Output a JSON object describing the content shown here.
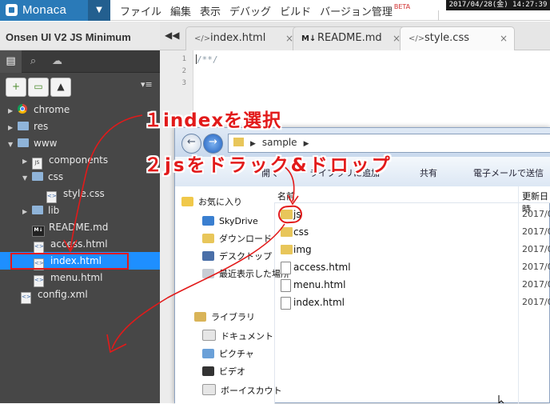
{
  "topbar": {
    "brand": "Monaca",
    "dropdown_icon": "▼",
    "menu": [
      "ファイル",
      "編集",
      "表示",
      "デバッグ",
      "ビルド",
      "バージョン管理"
    ],
    "beta": "BETA",
    "clock": "2017/04/28(金) 14:27:39"
  },
  "sidebar": {
    "project_title": "Onsen UI V2 JS Minimum",
    "tabs": [
      "files-icon",
      "search-icon",
      "cloud-icon"
    ],
    "tools": [
      "new-file-icon",
      "new-folder-icon",
      "upload-icon"
    ],
    "tree": [
      {
        "label": "chrome",
        "type": "chrome",
        "expanded": false
      },
      {
        "label": "res",
        "type": "folder",
        "expanded": false
      },
      {
        "label": "www",
        "type": "folder",
        "expanded": true
      },
      {
        "label": "components",
        "type": "js",
        "expanded": false
      },
      {
        "label": "css",
        "type": "folder",
        "expanded": true
      },
      {
        "label": "style.css",
        "type": "css"
      },
      {
        "label": "lib",
        "type": "folder",
        "expanded": false
      },
      {
        "label": "README.md",
        "type": "md"
      },
      {
        "label": "access.html",
        "type": "html"
      },
      {
        "label": "index.html",
        "type": "html",
        "selected": true
      },
      {
        "label": "menu.html",
        "type": "html"
      },
      {
        "label": "config.xml",
        "type": "xml"
      }
    ]
  },
  "editor": {
    "tabs": [
      {
        "label": "index.html",
        "icon": "code-icon"
      },
      {
        "label": "README.md",
        "icon": "markdown-icon"
      },
      {
        "label": "style.css",
        "icon": "code-icon",
        "active": true
      }
    ],
    "line_numbers": [
      "1",
      "2",
      "3"
    ],
    "code_line1": "/**/"
  },
  "explorer": {
    "path": "sample",
    "toolbar": [
      "開く",
      "ライブラリに追加",
      "共有",
      "電子メールで送信"
    ],
    "nav": [
      "お気に入り",
      "SkyDrive",
      "ダウンロード",
      "デスクトップ",
      "最近表示した場所",
      "ライブラリ",
      "ドキュメント",
      "ピクチャ",
      "ビデオ",
      "ボーイスカウト"
    ],
    "col_name": "名前",
    "col_date": "更新日時",
    "files": [
      {
        "name": "js",
        "type": "folder",
        "date": "2017/0"
      },
      {
        "name": "css",
        "type": "folder",
        "date": "2017/0"
      },
      {
        "name": "img",
        "type": "folder",
        "date": "2017/0"
      },
      {
        "name": "access.html",
        "type": "html",
        "date": "2017/0"
      },
      {
        "name": "menu.html",
        "type": "html",
        "date": "2017/0"
      },
      {
        "name": "index.html",
        "type": "html",
        "date": "2017/0"
      }
    ]
  },
  "annotations": {
    "step1": "１indexを選択",
    "step2": "２jsをドラック&ドロップ"
  },
  "colors": {
    "monaca_blue": "#2a7ab8",
    "selection": "#1e8fff",
    "annotation_red": "#e21a1a"
  }
}
